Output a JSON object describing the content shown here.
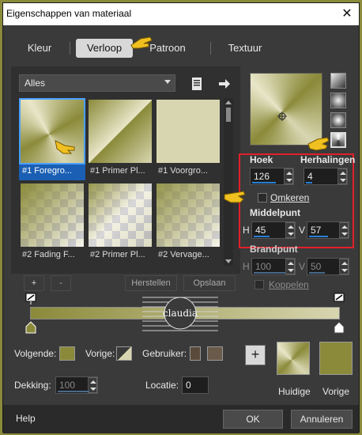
{
  "window": {
    "title": "Eigenschappen van materiaal",
    "close_glyph": "✕"
  },
  "tabs": [
    {
      "label": "Kleur",
      "active": false
    },
    {
      "label": "Verloop",
      "active": true
    },
    {
      "label": "Patroon",
      "active": false
    },
    {
      "label": "Textuur",
      "active": false
    }
  ],
  "library": {
    "dropdown_value": "Alles",
    "items": [
      {
        "label": "#1 Foregro..."
      },
      {
        "label": "#1 Primer Pl..."
      },
      {
        "label": "#1 Voorgro..."
      },
      {
        "label": "#2 Fading F..."
      },
      {
        "label": "#2 Primer Pl..."
      },
      {
        "label": "#2 Vervage..."
      }
    ],
    "add_label": "+",
    "remove_label": "-",
    "restore_label": "Herstellen",
    "save_label": "Opslaan"
  },
  "settings": {
    "angle_label": "Hoek",
    "angle_value": "126",
    "repeats_label": "Herhalingen",
    "repeats_value": "4",
    "invert_label": "Omkeren",
    "center_label": "Middelpunt",
    "h_label": "H",
    "h_value": "45",
    "v_label": "V",
    "v_value": "57",
    "focal_label": "Brandpunt",
    "focal_h_value": "100",
    "focal_v_value": "50",
    "link_label": "Koppelen"
  },
  "editor": {
    "follow_label": "Volgende:",
    "prev_label": "Vorige:",
    "user_label": "Gebruiker:",
    "opacity_label": "Dekking:",
    "opacity_value": "100",
    "location_label": "Locatie:",
    "location_value": "0"
  },
  "swatches": {
    "current_label": "Huidige",
    "previous_label": "Vorige",
    "add_label": "+"
  },
  "buttons": {
    "help": "Help",
    "ok": "OK",
    "cancel": "Annuleren"
  },
  "colors": {
    "olive": "#8b8a3a",
    "light_olive": "#d8d6b0",
    "accent": "#1a5fb4",
    "red_highlight": "#e0202a"
  }
}
